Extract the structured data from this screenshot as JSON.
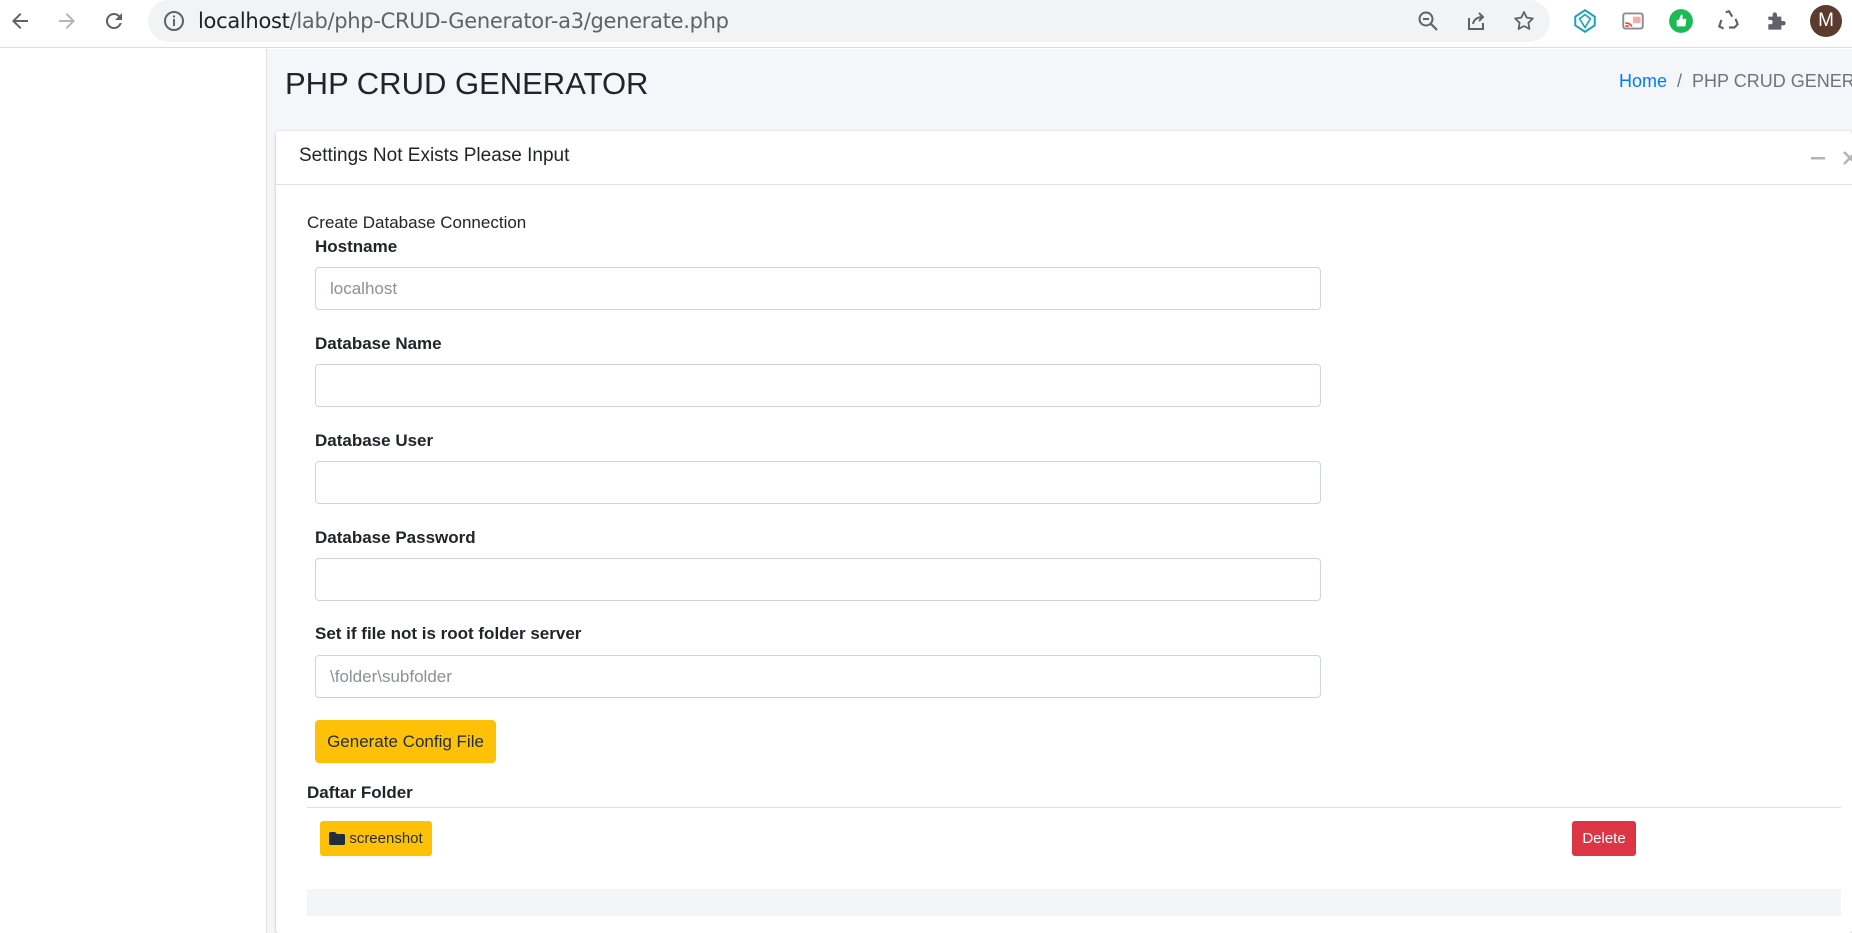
{
  "browser": {
    "url_host": "localhost",
    "url_path": "/lab/php-CRUD-Generator-a3/generate.php",
    "profile_initial": "M",
    "icons": {
      "back": "arrow-left-icon",
      "forward": "arrow-right-icon",
      "reload": "reload-icon",
      "site_info": "info-icon",
      "zoom": "zoom-out-icon",
      "share": "share-icon",
      "bookmark": "star-icon",
      "extensions": [
        "gem-extension-icon",
        "cast-extension-icon",
        "thumbs-up-extension-icon",
        "recycle-extension-icon",
        "puzzle-icon"
      ]
    }
  },
  "header": {
    "title": "PHP CRUD GENERATOR",
    "breadcrumb": {
      "home": "Home",
      "separator": "/",
      "current": "PHP CRUD GENERATOR"
    }
  },
  "card": {
    "title": "Settings Not Exists Please Input",
    "tools": {
      "collapse": "minus-icon",
      "close": "close-icon"
    }
  },
  "form": {
    "heading": "Create Database Connection",
    "fields": [
      {
        "label": "Hostname",
        "value": "",
        "placeholder": "localhost"
      },
      {
        "label": "Database Name",
        "value": "",
        "placeholder": ""
      },
      {
        "label": "Database User",
        "value": "",
        "placeholder": ""
      },
      {
        "label": "Database Password",
        "value": "",
        "placeholder": ""
      },
      {
        "label": "Set if file not is root folder server",
        "value": "",
        "placeholder": "\\folder\\subfolder"
      }
    ],
    "submit_label": "Generate Config File"
  },
  "folders": {
    "heading": "Daftar Folder",
    "items": [
      {
        "name": "screenshot",
        "icon": "folder-icon",
        "delete_label": "Delete"
      }
    ]
  },
  "colors": {
    "warning": "#ffc107",
    "danger": "#dc3545",
    "link": "#007bff",
    "content_bg": "#f4f6f9"
  }
}
